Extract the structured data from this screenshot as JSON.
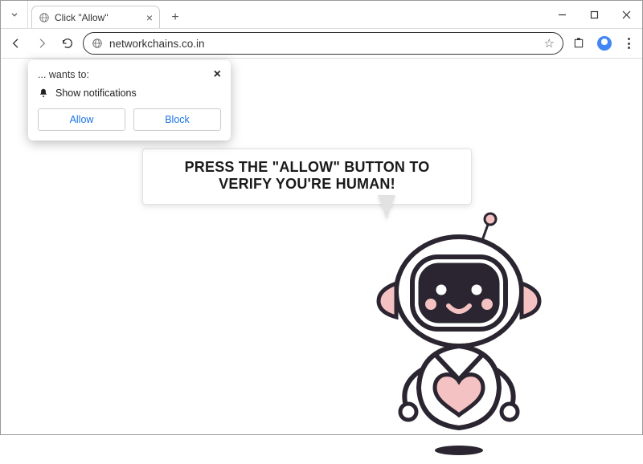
{
  "tab": {
    "title": "Click \"Allow\""
  },
  "address_bar": {
    "url": "networkchains.co.in"
  },
  "permission_prompt": {
    "site_label": "... wants to:",
    "permission_text": "Show notifications",
    "allow_label": "Allow",
    "block_label": "Block"
  },
  "page": {
    "bubble_text": "PRESS THE \"ALLOW\" BUTTON TO VERIFY YOU'RE HUMAN!"
  }
}
